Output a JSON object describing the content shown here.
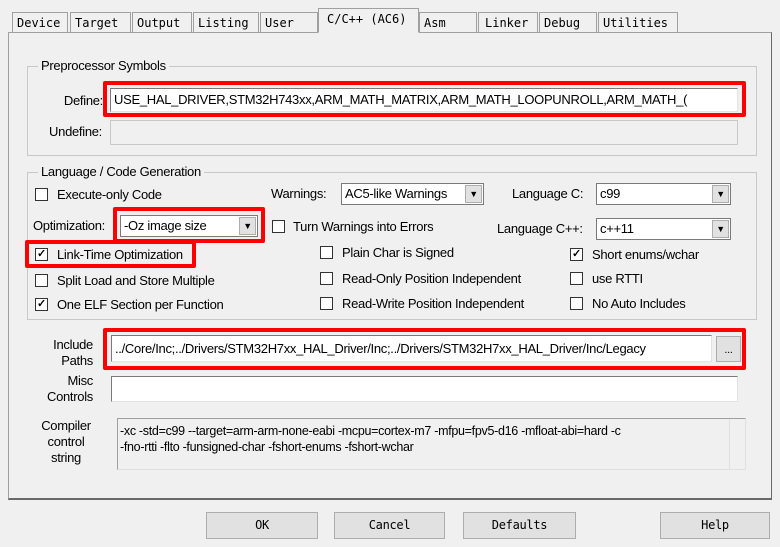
{
  "tabs": [
    "Device",
    "Target",
    "Output",
    "Listing",
    "User",
    "C/C++ (AC6)",
    "Asm",
    "Linker",
    "Debug",
    "Utilities"
  ],
  "active_tab": "C/C++ (AC6)",
  "preprocessor": {
    "title": "Preprocessor Symbols",
    "define_label": "Define:",
    "define_value": "USE_HAL_DRIVER,STM32H743xx,ARM_MATH_MATRIX,ARM_MATH_LOOPUNROLL,ARM_MATH_(",
    "undefine_label": "Undefine:",
    "undefine_value": ""
  },
  "language": {
    "title": "Language / Code Generation",
    "execute_only": {
      "label": "Execute-only Code",
      "checked": false
    },
    "optimization_label": "Optimization:",
    "optimization_value": "-Oz image size",
    "lto": {
      "label": "Link-Time Optimization",
      "checked": true
    },
    "split_load": {
      "label": "Split Load and Store Multiple",
      "checked": false
    },
    "one_elf": {
      "label": "One ELF Section per Function",
      "checked": true
    },
    "warnings_label": "Warnings:",
    "warnings_value": "AC5-like Warnings",
    "turn_warnings": {
      "label": "Turn Warnings into Errors",
      "checked": false
    },
    "plain_char": {
      "label": "Plain Char is Signed",
      "checked": false
    },
    "ropi": {
      "label": "Read-Only Position Independent",
      "checked": false
    },
    "rwpi": {
      "label": "Read-Write Position Independent",
      "checked": false
    },
    "lang_c_label": "Language C:",
    "lang_c_value": "c99",
    "lang_cpp_label": "Language C++:",
    "lang_cpp_value": "c++11",
    "short_enums": {
      "label": "Short enums/wchar",
      "checked": true
    },
    "rtti": {
      "label": "use RTTI",
      "checked": false
    },
    "no_auto": {
      "label": "No Auto Includes",
      "checked": false
    }
  },
  "include": {
    "label1": "Include",
    "label2": "Paths",
    "value": "../Core/Inc;../Drivers/STM32H7xx_HAL_Driver/Inc;../Drivers/STM32H7xx_HAL_Driver/Inc/Legacy",
    "browse": "..."
  },
  "misc": {
    "label1": "Misc",
    "label2": "Controls",
    "value": ""
  },
  "compiler": {
    "label1": "Compiler",
    "label2": "control",
    "label3": "string",
    "line1": "-xc -std=c99 --target=arm-arm-none-eabi -mcpu=cortex-m7 -mfpu=fpv5-d16 -mfloat-abi=hard -c",
    "line2": "-fno-rtti -flto -funsigned-char -fshort-enums -fshort-wchar"
  },
  "buttons": {
    "ok": "OK",
    "cancel": "Cancel",
    "defaults": "Defaults",
    "help": "Help"
  },
  "highlight_color": "#ff0000"
}
